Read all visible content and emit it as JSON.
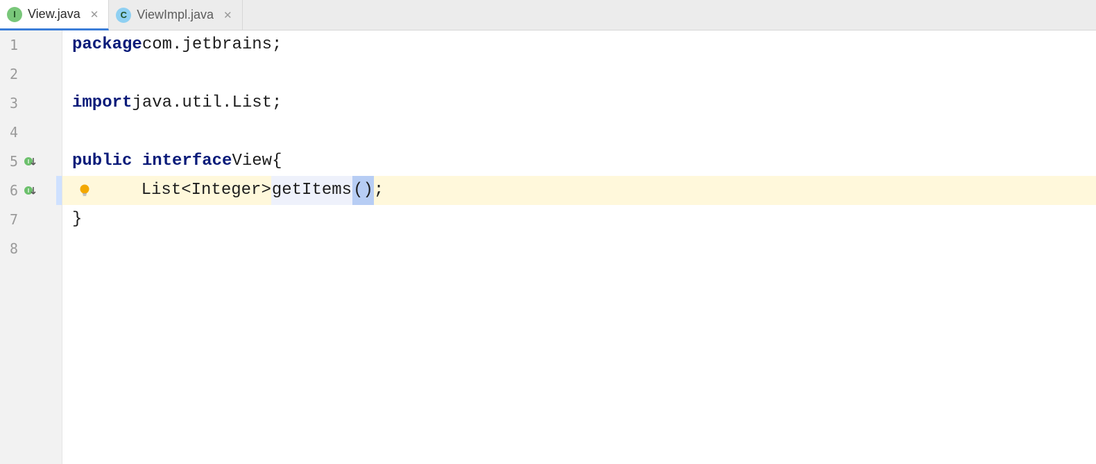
{
  "tabs": [
    {
      "icon_letter": "I",
      "icon_kind": "interface",
      "label": "View.java",
      "active": true
    },
    {
      "icon_letter": "C",
      "icon_kind": "class",
      "label": "ViewImpl.java",
      "active": false
    }
  ],
  "gutter_lines": [
    {
      "num": "1",
      "marker": null,
      "sel": false
    },
    {
      "num": "2",
      "marker": null,
      "sel": false
    },
    {
      "num": "3",
      "marker": null,
      "sel": false
    },
    {
      "num": "4",
      "marker": null,
      "sel": false
    },
    {
      "num": "5",
      "marker": "implement",
      "sel": false
    },
    {
      "num": "6",
      "marker": "implement",
      "sel": true
    },
    {
      "num": "7",
      "marker": null,
      "sel": false
    },
    {
      "num": "8",
      "marker": null,
      "sel": false
    }
  ],
  "code": {
    "l1": {
      "kw": "package",
      "rest": " com.jetbrains;"
    },
    "l3": {
      "kw": "import",
      "rest": " java.util.List;"
    },
    "l5": {
      "kw1": "public",
      "kw2": "interface",
      "name": " View ",
      "brace": "{"
    },
    "l6": {
      "indent": "    ",
      "ret_type": "List<Integer> ",
      "method_name": "getItems",
      "parens": "()",
      "semi": ";"
    },
    "l7": {
      "brace": "}"
    }
  }
}
